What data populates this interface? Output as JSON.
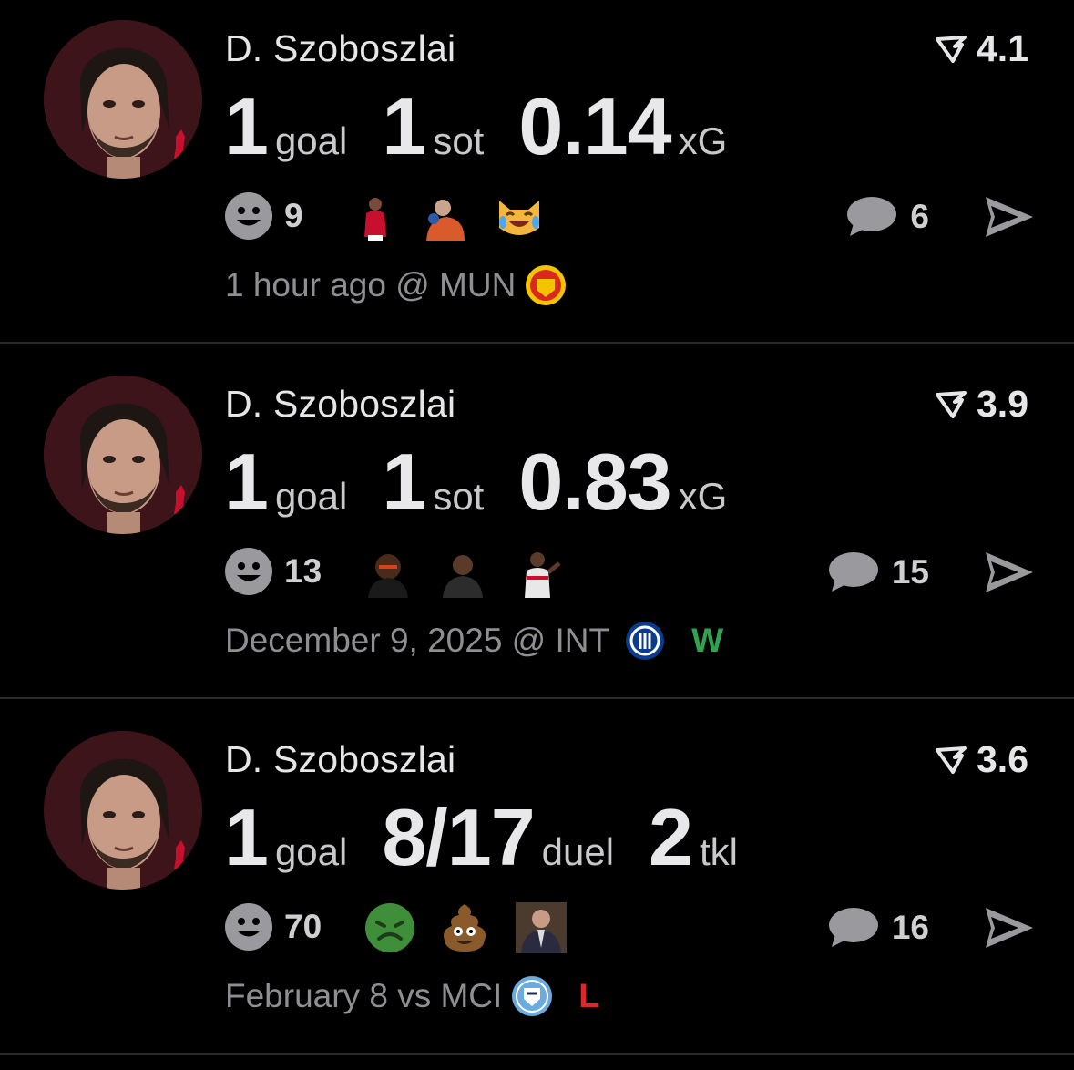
{
  "cards": [
    {
      "player": "D. Szoboszlai",
      "club_badge": "L.F.C.",
      "rating": "4.1",
      "stats": [
        {
          "value": "1",
          "unit": "goal"
        },
        {
          "value": "1",
          "unit": "sot"
        },
        {
          "value": "0.14",
          "unit": "xG"
        }
      ],
      "reaction_count": "9",
      "reactions": [
        "player-sticker",
        "player-sticker",
        "laughing-cat-emoji"
      ],
      "comment_count": "6",
      "meta_text": "1 hour ago @ MUN",
      "opponent_crest": "manchester-united-crest-icon",
      "result": "",
      "result_color": ""
    },
    {
      "player": "D. Szoboszlai",
      "club_badge": "L.F.C.",
      "rating": "3.9",
      "stats": [
        {
          "value": "1",
          "unit": "goal"
        },
        {
          "value": "1",
          "unit": "sot"
        },
        {
          "value": "0.83",
          "unit": "xG"
        }
      ],
      "reaction_count": "13",
      "reactions": [
        "player-sticker",
        "player-sticker",
        "player-sticker"
      ],
      "comment_count": "15",
      "meta_text": "December 9, 2025 @ INT",
      "opponent_crest": "inter-crest-icon",
      "result": "W",
      "result_color": "#2ea44f"
    },
    {
      "player": "D. Szoboszlai",
      "club_badge": "L.F.C.",
      "rating": "3.6",
      "stats": [
        {
          "value": "1",
          "unit": "goal"
        },
        {
          "value": "8/17",
          "unit": "duel"
        },
        {
          "value": "2",
          "unit": "tkl"
        }
      ],
      "reaction_count": "70",
      "reactions": [
        "nauseated-face-emoji",
        "pile-of-poo-emoji",
        "person-sticker"
      ],
      "comment_count": "16",
      "meta_text": "February 8 vs MCI",
      "opponent_crest": "manchester-city-crest-icon",
      "result": "L",
      "result_color": "#e0262b"
    }
  ],
  "colors": {
    "background": "#000000",
    "text_primary": "#e8e8ea",
    "text_muted": "#8f8f93",
    "icon_gray": "#9a9a9e",
    "lfc_red": "#c8102e"
  }
}
